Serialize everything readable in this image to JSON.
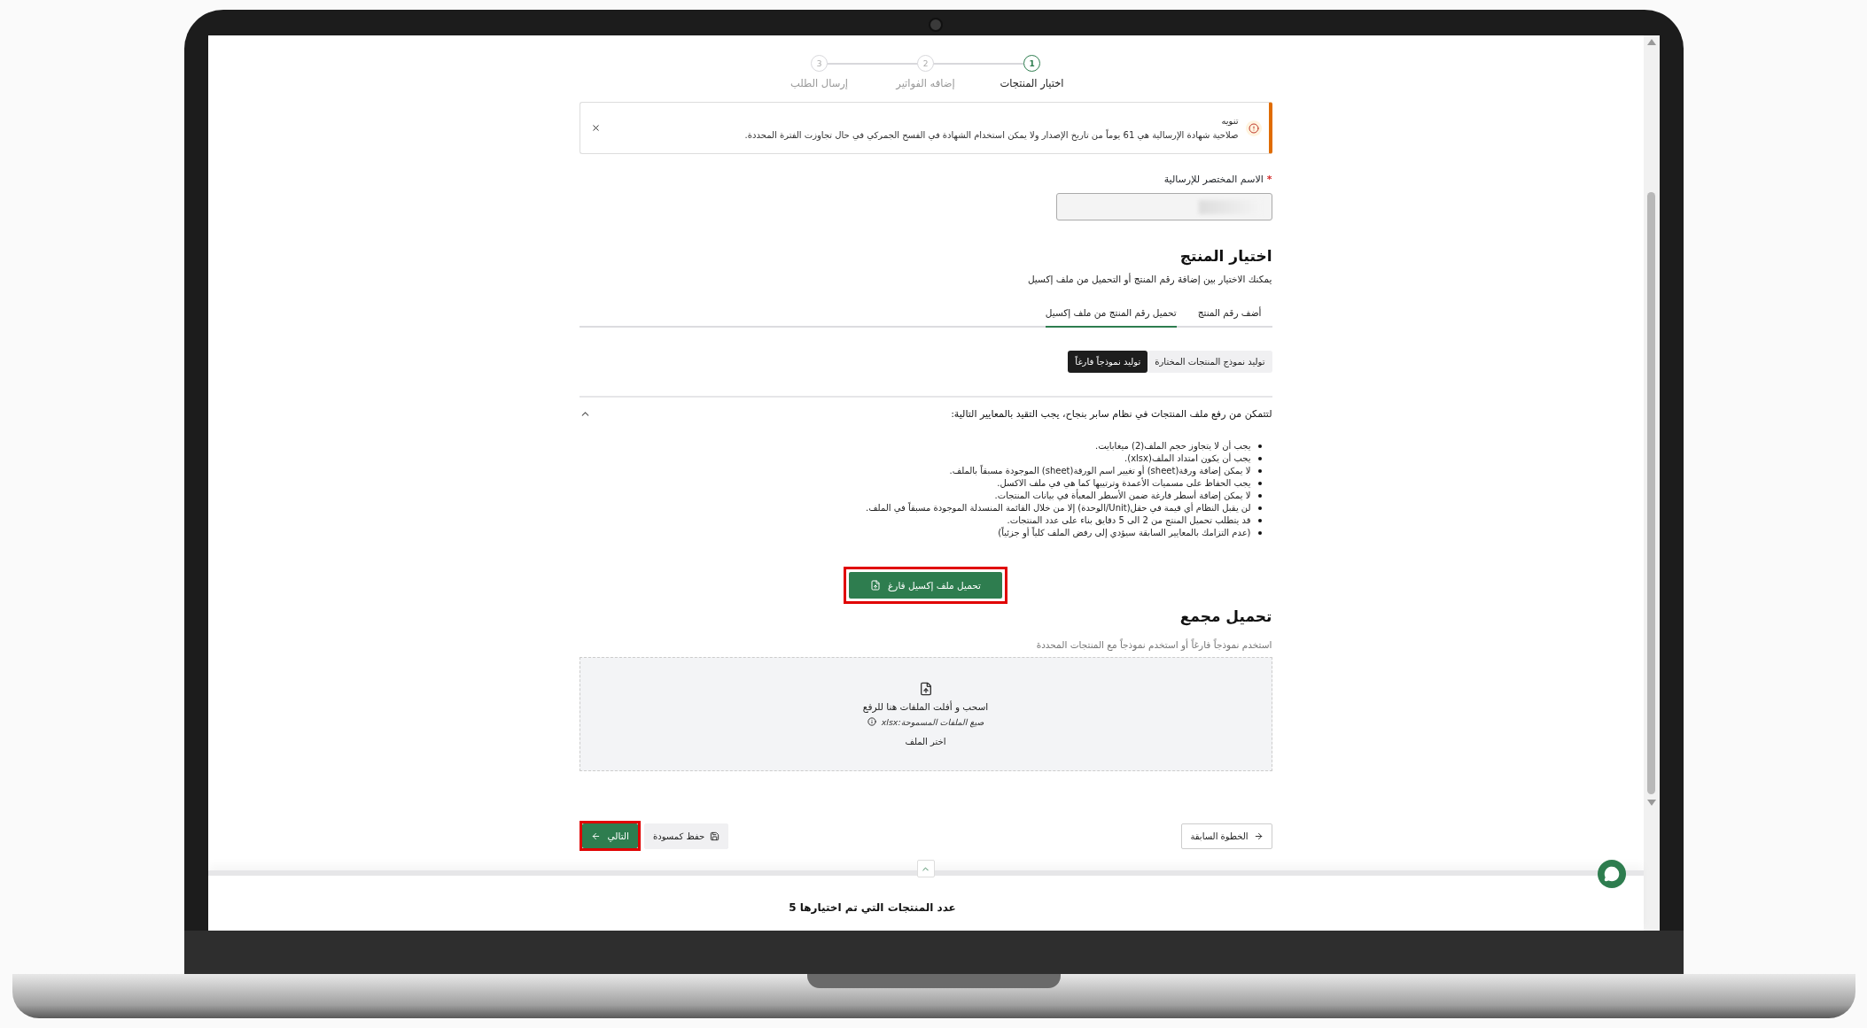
{
  "stepper": [
    {
      "number": "1",
      "label": "اختيار المنتجات",
      "selected": true
    },
    {
      "number": "2",
      "label": "إضافه الفواتير",
      "selected": false
    },
    {
      "number": "3",
      "label": "إرسال الطلب",
      "selected": false
    }
  ],
  "alert": {
    "title": "تنويه",
    "message": "صلاحية شهادة الإرسالية هي 61 يوماً من تاريخ الإصدار ولا يمكن استخدام الشهادة في الفسح الجمركي في حال تجاوزت الفترة المحددة."
  },
  "name_field": {
    "label": "الاسم المختصر للإرسالية",
    "required_mark": "*"
  },
  "product_section": {
    "title": "اختيار المنتج",
    "subtitle": "يمكنك الاختيار بين إضافة رقم المنتج أو التحميل من ملف إكسيل"
  },
  "tabs": [
    {
      "label": "أضف رقم المنتج",
      "selected": false
    },
    {
      "label": "تحميل رقم المنتج من ملف إكسيل",
      "selected": true
    }
  ],
  "template_options": [
    {
      "label": "توليد نموذج المنتجات المختارة",
      "selected": false
    },
    {
      "label": "توليد نموذجاً فارغاً",
      "selected": true
    }
  ],
  "requirements": {
    "title": "لتتمكن من رفع ملف المنتجات في نظام سابر بنجاح، يجب التقيد بالمعايير التالية:",
    "expanded": true,
    "items": [
      "يجب أن لا يتجاوز حجم الملف(2) ميغابايت.",
      "يجب أن يكون امتداد الملف(xlsx).",
      "لا يمكن إضافة ورقة(sheet) أو تغيير اسم الورقة(sheet) الموجودة مسبقاً بالملف.",
      "يجب الحفاظ على مسميات الأعمدة وترتيبها كما هي في ملف الاكسل.",
      "لا يمكن إضافة أسطر فارغة ضمن الأسطر المعبأة في بيانات المنتجات.",
      "لن يقبل النظام أي قيمة في حقل(Unit/الوحدة) إلا من خلال القائمة المنسدلة الموجودة مسبقاً في الملف.",
      "قد يتطلب تحميل المنتج من 2 الى 5 دقايق بناء على عدد المنتجات.",
      "(عدم التزامك بالمعايير السابقة سيؤدي إلى رفض الملف كلياً أو جزئياً)"
    ]
  },
  "upload_template_button": {
    "label": "تحميل ملف إكسيل فارغ",
    "highlighted": true
  },
  "bulk_upload": {
    "title": "تحميل مجمع",
    "subtitle": "استخدم نموذجاً فارغاً أو استخدم نموذجاً مع المنتجات المحددة",
    "drop_text": "اسحب و أفلت الملفات هنا للرفع",
    "formats": "صيغ الملفات المسموحة:xlsx",
    "choose": "اختر الملف"
  },
  "actions": {
    "previous": {
      "label": "الخطوة السابقة"
    },
    "save_draft": {
      "label": "حفظ كمسودة"
    },
    "next": {
      "label": "التالي",
      "highlighted": true
    }
  },
  "footer": {
    "count_text": "عدد المنتجات التي تم اختيارها 5"
  }
}
